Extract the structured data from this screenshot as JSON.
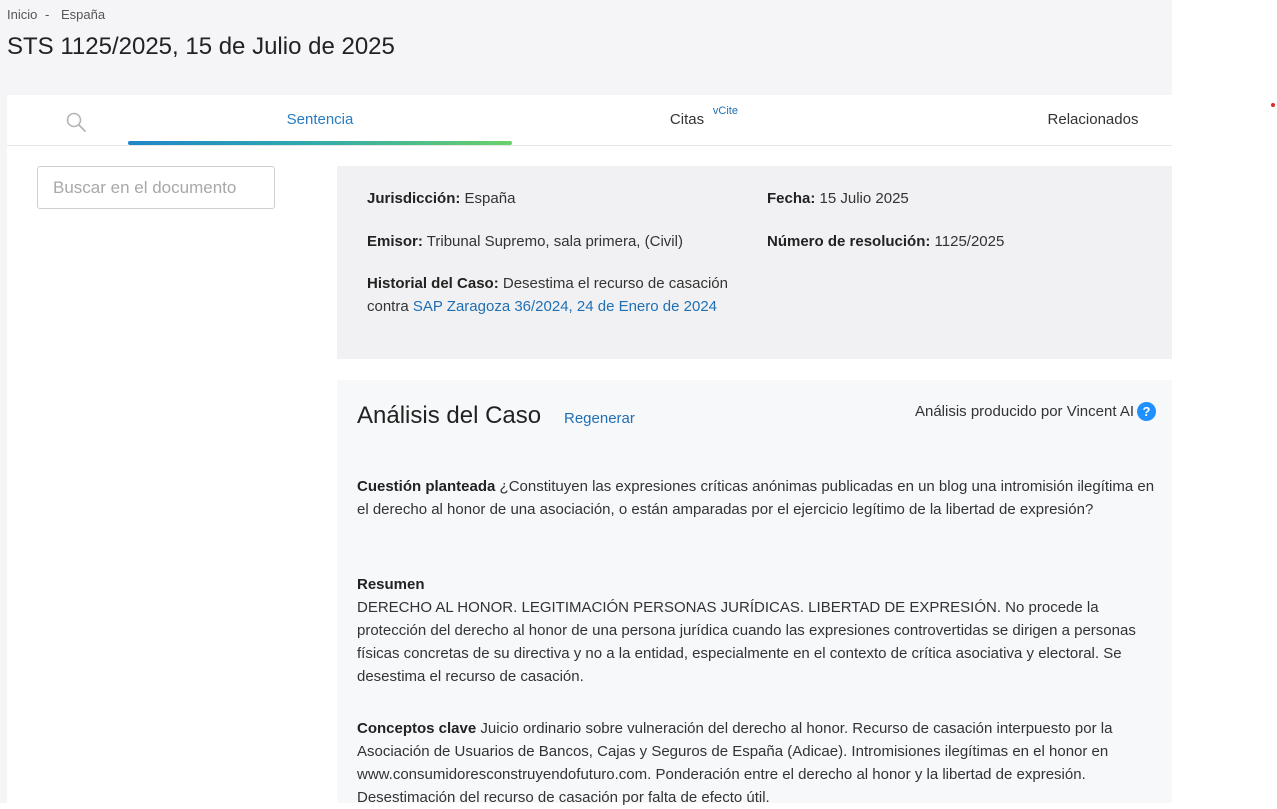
{
  "breadcrumb": {
    "home": "Inicio",
    "separator": "-",
    "current": "España"
  },
  "page_title": "STS 1125/2025, 15 de Julio de 2025",
  "tabs": {
    "search_icon": "search-icon",
    "sentencia": "Sentencia",
    "citas": "Citas",
    "vcite": "vCite",
    "relacionados": "Relacionados",
    "active_gradient": [
      "#1f86c8",
      "#2ea8b0",
      "#6bd06a"
    ]
  },
  "doc_search": {
    "placeholder": "Buscar en el documento"
  },
  "meta": {
    "jurisdiccion_label": "Jurisdicción:",
    "jurisdiccion_value": "España",
    "fecha_label": "Fecha:",
    "fecha_value": "15 Julio 2025",
    "emisor_label": "Emisor:",
    "emisor_value": "Tribunal Supremo, sala primera, (Civil)",
    "numero_label": "Número de resolución:",
    "numero_value": "1125/2025",
    "historial_label": "Historial del Caso:",
    "historial_text": "Desestima el recurso de casación contra",
    "historial_link": "SAP Zaragoza 36/2024, 24 de Enero de 2024"
  },
  "analysis": {
    "title": "Análisis del Caso",
    "regenerar": "Regenerar",
    "produced_by": "Análisis producido por Vincent AI",
    "help_icon": "?",
    "cuestion_label": "Cuestión planteada",
    "cuestion_text": "¿Constituyen las expresiones críticas anónimas publicadas en un blog una intromisión ilegítima en el derecho al honor de una asociación, o están amparadas por el ejercicio legítimo de la libertad de expresión?",
    "resumen_label": "Resumen",
    "resumen_text": "DERECHO AL HONOR. LEGITIMACIÓN PERSONAS JURÍDICAS. LIBERTAD DE EXPRESIÓN. No procede la protección del derecho al honor de una persona jurídica cuando las expresiones controvertidas se dirigen a personas físicas concretas de su directiva y no a la entidad, especialmente en el contexto de crítica asociativa y electoral. Se desestima el recurso de casación.",
    "conceptos_label": "Conceptos clave",
    "conceptos_text": "Juicio ordinario sobre vulneración del derecho al honor. Recurso de casación interpuesto por la Asociación de Usuarios de Bancos, Cajas y Seguros de España (Adicae). Intromisiones ilegítimas en el honor en www.consumidoresconstruyendofuturo.com. Ponderación entre el derecho al honor y la libertad de expresión. Desestimación del recurso de casación por falta de efecto útil."
  },
  "colors": {
    "link": "#1f6fb5",
    "help": "#1e90ff",
    "page_bg": "#f5f5f7"
  }
}
